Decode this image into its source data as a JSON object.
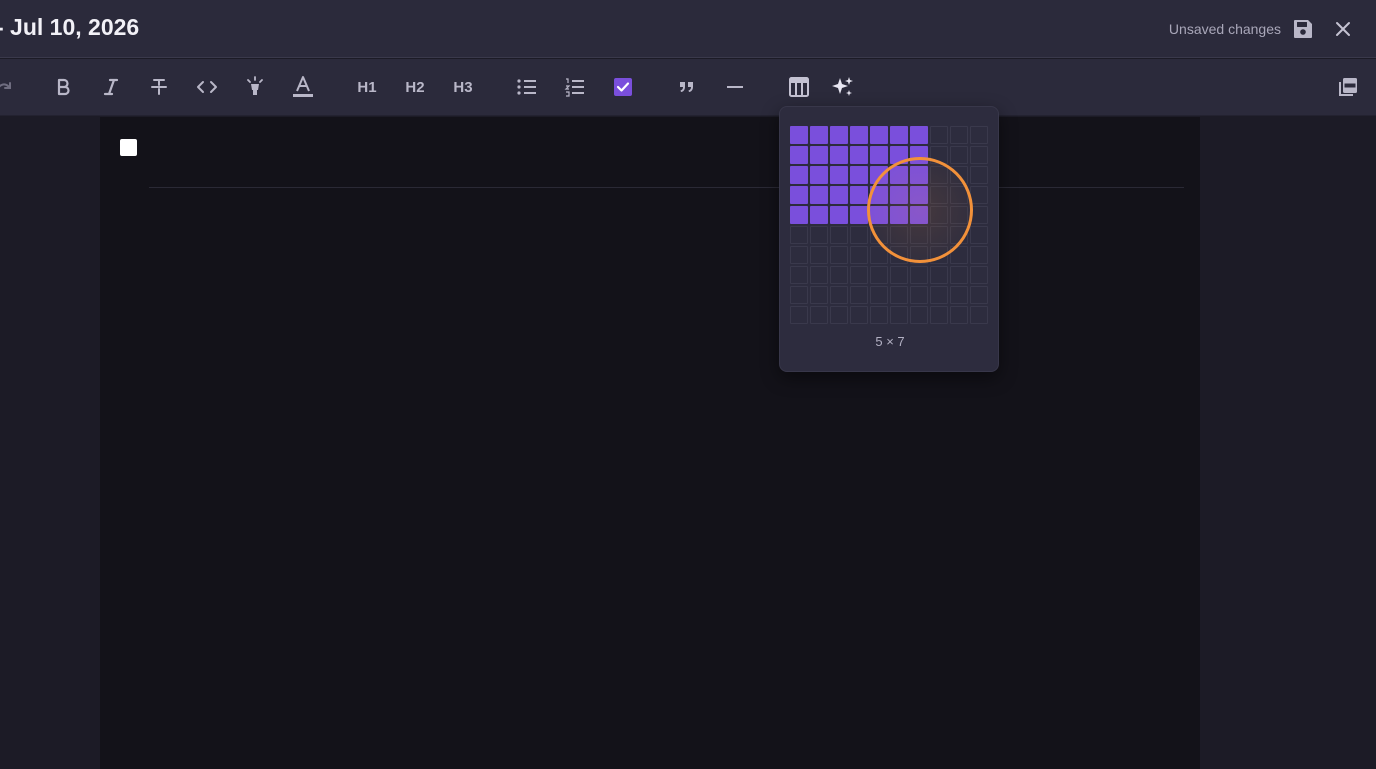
{
  "header": {
    "title": "- Jul 10, 2026",
    "status": "Unsaved changes",
    "save_icon": "floppy-disk-icon",
    "close_icon": "close-icon"
  },
  "toolbar": {
    "redo_icon": "redo-icon",
    "bold_icon": "bold-icon",
    "italic_icon": "italic-icon",
    "strike_icon": "strikethrough-icon",
    "code_icon": "code-icon",
    "highlight_icon": "highlighter-icon",
    "text_color_icon": "text-color-icon",
    "h1": "H1",
    "h2": "H2",
    "h3": "H3",
    "bullet_list_icon": "bullet-list-icon",
    "ordered_list_icon": "ordered-list-icon",
    "task_list_icon": "task-list-icon",
    "quote_icon": "quote-icon",
    "divider_icon": "horizontal-rule-icon",
    "table_icon": "table-icon",
    "ai_icon": "sparkles-icon",
    "pdf_icon": "pdf-export-icon",
    "accent": "#7a4fdc"
  },
  "table_picker": {
    "grid_rows": 10,
    "grid_cols": 10,
    "selected_rows": 5,
    "selected_cols": 7,
    "label": "5 × 7",
    "selected_color": "#7a4fdc"
  },
  "editor": {
    "task_checked": false
  }
}
